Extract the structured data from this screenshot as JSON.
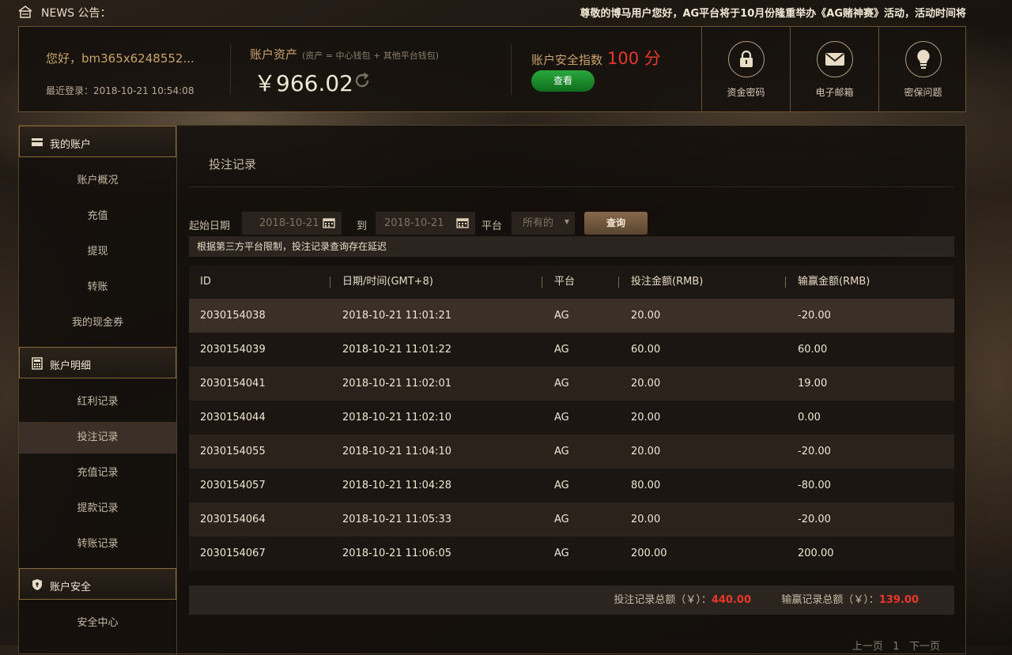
{
  "news": {
    "label": "NEWS 公告：",
    "marquee": "尊敬的博马用户您好，AG平台将于10月份隆重举办《AG赌神赛》活动，活动时间将"
  },
  "header": {
    "greeting": "您好，bm365x6248552...",
    "last_login": "最近登录：2018-10-21 10:54:08",
    "assets_title": "账户资产",
    "assets_sub": "(资产 = 中心钱包 + 其他平台钱包)",
    "balance": "￥966.02",
    "security_title": "账户安全指数",
    "security_score": "100 分",
    "check_label": "查看",
    "tiles": [
      {
        "label": "资金密码",
        "icon": "lock-icon"
      },
      {
        "label": "电子邮箱",
        "icon": "mail-icon"
      },
      {
        "label": "密保问题",
        "icon": "bulb-icon"
      }
    ]
  },
  "sidebar": {
    "sections": [
      {
        "title": "我的账户",
        "icon": "card-icon",
        "items": [
          "账户概况",
          "充值",
          "提现",
          "转账",
          "我的现金券"
        ]
      },
      {
        "title": "账户明细",
        "icon": "calculator-icon",
        "items": [
          "红利记录",
          "投注记录",
          "充值记录",
          "提款记录",
          "转账记录"
        ]
      },
      {
        "title": "账户安全",
        "icon": "shield-icon",
        "items": [
          "安全中心"
        ]
      }
    ],
    "active_item": "投注记录"
  },
  "content": {
    "title": "投注记录",
    "filter": {
      "start_label": "起始日期",
      "start_value": "2018-10-21",
      "to_label": "到",
      "end_value": "2018-10-21",
      "platform_label": "平台",
      "platform_value": "所有的",
      "query_label": "查询"
    },
    "notice": "根据第三方平台限制，投注记录查询存在延迟",
    "table": {
      "headers": [
        "ID",
        "日期/时间(GMT+8)",
        "平台",
        "投注金额(RMB)",
        "输赢金额(RMB)"
      ],
      "rows": [
        [
          "2030154038",
          "2018-10-21 11:01:21",
          "AG",
          "20.00",
          "-20.00"
        ],
        [
          "2030154039",
          "2018-10-21 11:01:22",
          "AG",
          "60.00",
          "60.00"
        ],
        [
          "2030154041",
          "2018-10-21 11:02:01",
          "AG",
          "20.00",
          "19.00"
        ],
        [
          "2030154044",
          "2018-10-21 11:02:10",
          "AG",
          "20.00",
          "0.00"
        ],
        [
          "2030154055",
          "2018-10-21 11:04:10",
          "AG",
          "20.00",
          "-20.00"
        ],
        [
          "2030154057",
          "2018-10-21 11:04:28",
          "AG",
          "80.00",
          "-80.00"
        ],
        [
          "2030154064",
          "2018-10-21 11:05:33",
          "AG",
          "20.00",
          "-20.00"
        ],
        [
          "2030154067",
          "2018-10-21 11:06:05",
          "AG",
          "200.00",
          "200.00"
        ]
      ]
    },
    "totals": {
      "bet_label": "投注记录总额（￥）：",
      "bet_value": "440.00",
      "win_label": "输赢记录总额（￥）：",
      "win_value": "139.00"
    },
    "pager": {
      "prev": "上一页",
      "page": "1",
      "next": "下一页"
    }
  },
  "colors": {
    "accent_red": "#e8372b",
    "gold_border": "#8a6a3a",
    "button_green": "#1f8f30"
  }
}
